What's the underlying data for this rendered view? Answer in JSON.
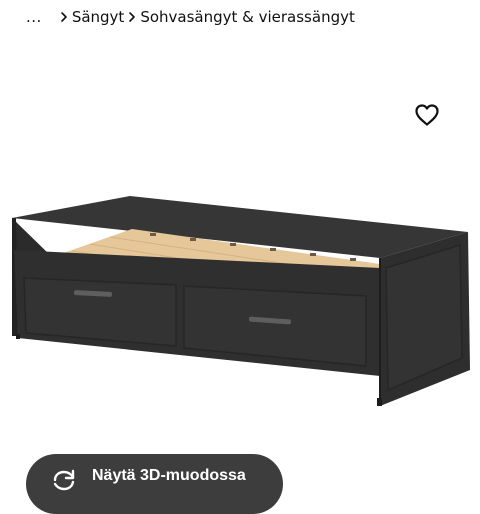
{
  "breadcrumb": {
    "ellipsis": "...",
    "items": [
      {
        "label": "Sängyt"
      },
      {
        "label": "Sohvasängyt & vierassängyt"
      }
    ]
  },
  "product": {
    "image_icon": "daybed-product-photo",
    "favorite_icon": "heart-outline-icon"
  },
  "actions": {
    "view_3d_label": "Näytä 3D-muodossa",
    "view_3d_icon": "rotate-3d-icon"
  },
  "colors": {
    "button_bg": "#3d3d3d",
    "bed_frame": "#2f2f2f",
    "slats": "#e6c79a"
  }
}
